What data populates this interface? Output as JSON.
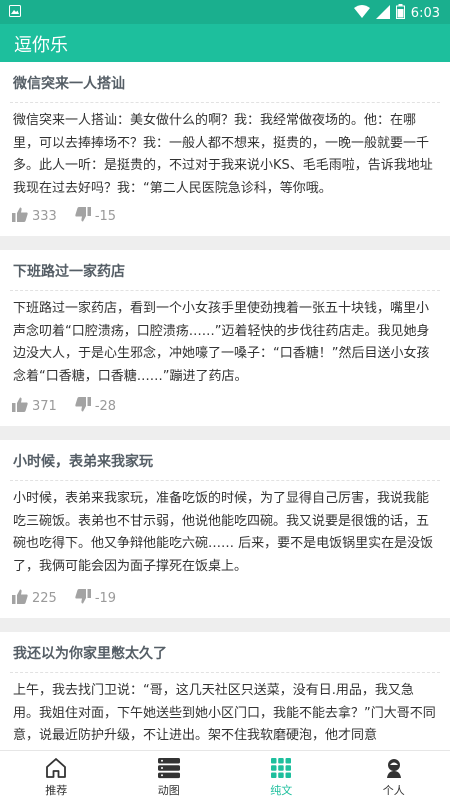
{
  "status_bar": {
    "time": "6:03",
    "left_icon": "image-icon",
    "icons": [
      "wifi-icon",
      "signal-icon",
      "battery-icon"
    ]
  },
  "app_bar": {
    "title": "逗你乐"
  },
  "feed": {
    "items": [
      {
        "title": "微信突来一人搭讪",
        "body": "微信突来一人搭讪：美女做什么的啊？我：我经常做夜场的。他：在哪里，可以去捧捧场不？我：一般人都不想来，挺贵的，一晚一般就要一千多。此人一听：是挺贵的，不过对于我来说小KS、毛毛雨啦，告诉我地址我现在过去好吗？我：“第二人民医院急诊科，等你哦。",
        "likes": "333",
        "dislikes": "-15"
      },
      {
        "title": "下班路过一家药店",
        "body": "下班路过一家药店，看到一个小女孩手里使劲拽着一张五十块钱，嘴里小声念叨着“口腔溃疡，口腔溃疡……”迈着轻快的步伐往药店走。我见她身边没大人，于是心生邪念，冲她嚎了一嗓子：“口香糖！”然后目送小女孩念着“口香糖，口香糖……”蹦进了药店。",
        "likes": "371",
        "dislikes": "-28"
      },
      {
        "title": "小时候，表弟来我家玩",
        "body": "小时候，表弟来我家玩，准备吃饭的时候，为了显得自己厉害，我说我能吃三碗饭。表弟也不甘示弱，他说他能吃四碗。我又说要是很饿的话，五碗也吃得下。他又争辩他能吃六碗…… 后来，要不是电饭锅里实在是没饭了，我俩可能会因为面子撑死在饭桌上。",
        "likes": "225",
        "dislikes": "-19"
      },
      {
        "title": "我还以为你家里憋太久了",
        "body": "上午，我去找门卫说：“哥，这几天社区只送菜，没有日.用品，我又急用。我姐住对面，下午她送些到她小区门口，我能不能去拿？”门大哥不同意，说最近防护升级，不让进出。架不住我软磨硬泡，他才同意",
        "likes": "",
        "dislikes": ""
      }
    ]
  },
  "bottom_nav": {
    "items": [
      {
        "label": "推荐",
        "icon": "home-icon"
      },
      {
        "label": "动图",
        "icon": "stack-icon"
      },
      {
        "label": "纯文",
        "icon": "grid-icon",
        "active": true
      },
      {
        "label": "个人",
        "icon": "person-icon"
      }
    ],
    "accent": "#1dbf9d"
  },
  "colors": {
    "status_bar": "#1aaf8e",
    "app_bar": "#1dbf9d",
    "background": "#eeeeee"
  }
}
